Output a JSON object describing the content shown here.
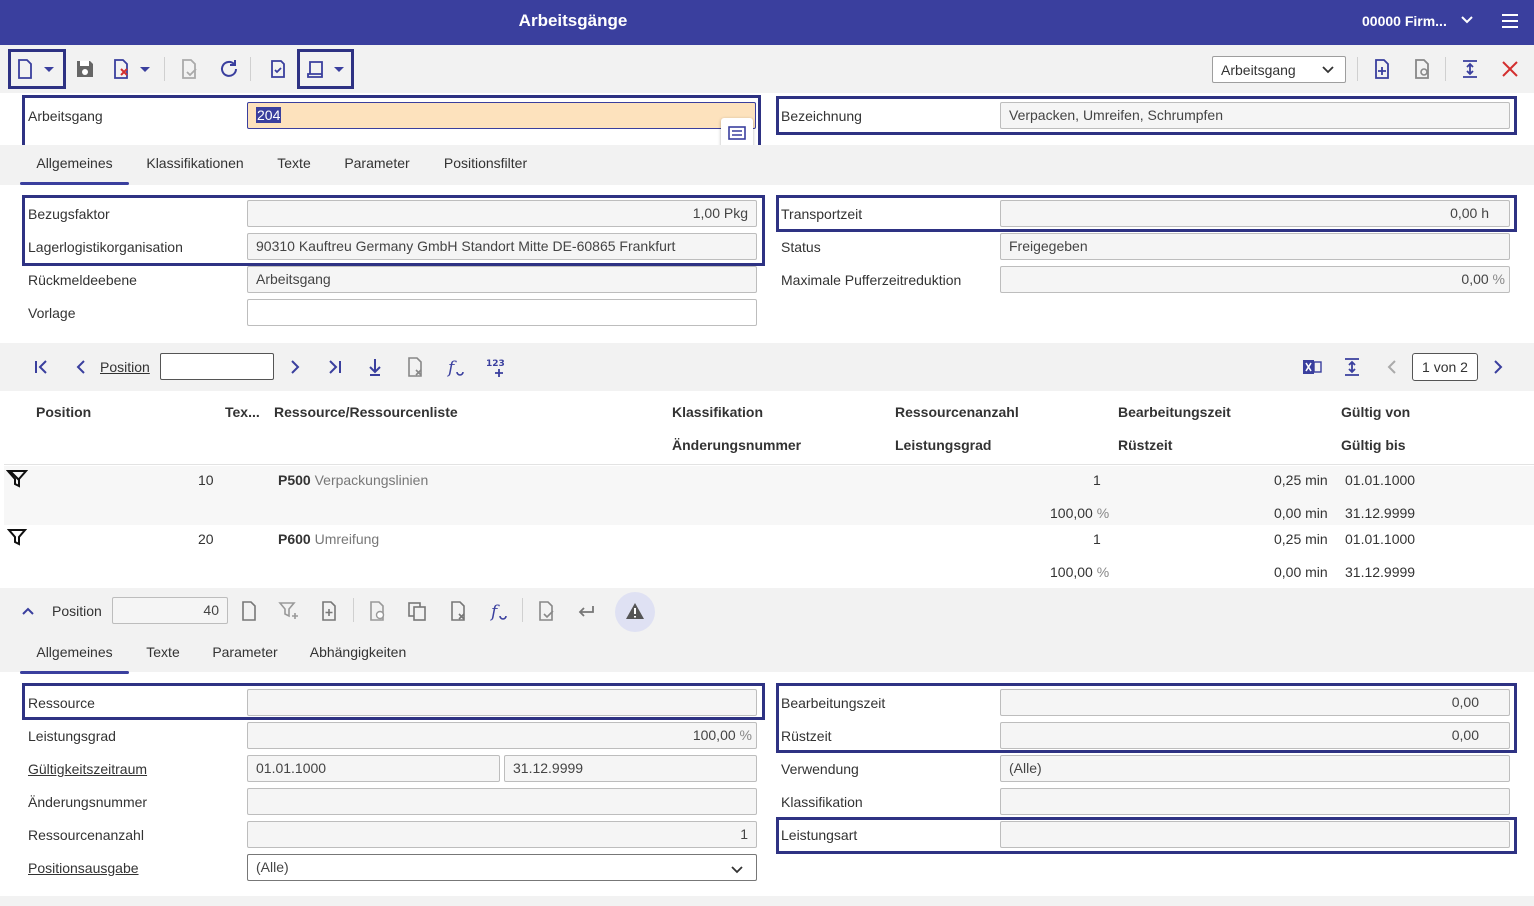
{
  "header": {
    "title": "Arbeitsgänge",
    "company": "00000 Firm..."
  },
  "toolbar": {
    "view_select": "Arbeitsgang"
  },
  "top": {
    "arbeitsgang_label": "Arbeitsgang",
    "arbeitsgang_value": "204",
    "bezeichnung_label": "Bezeichnung",
    "bezeichnung_value": "Verpacken, Umreifen, Schrumpfen"
  },
  "tabs": [
    "Allgemeines",
    "Klassifikationen",
    "Texte",
    "Parameter",
    "Positionsfilter"
  ],
  "general": {
    "bezugsfaktor_label": "Bezugsfaktor",
    "bezugsfaktor_value": "1,00 Pkg",
    "lager_label": "Lagerlogistikorganisation",
    "lager_value": "90310 Kauftreu Germany GmbH Standort Mitte DE-60865 Frankfurt",
    "rueck_label": "Rückmeldeebene",
    "rueck_value": "Arbeitsgang",
    "vorlage_label": "Vorlage",
    "vorlage_value": "",
    "transport_label": "Transportzeit",
    "transport_value": "0,00 h",
    "status_label": "Status",
    "status_value": "Freigegeben",
    "puffer_label": "Maximale Pufferzeitreduktion",
    "puffer_value": "0,00",
    "puffer_unit": "%"
  },
  "grid_toolbar": {
    "position_label": "Position",
    "pager": "1 von 2"
  },
  "table": {
    "headers": {
      "position": "Position",
      "text": "Tex...",
      "ressource": "Ressource/Ressourcenliste",
      "klassifikation": "Klassifikation",
      "anzahl": "Ressourcenanzahl",
      "bearbeitungszeit": "Bearbeitungszeit",
      "gueltig_von": "Gültig von",
      "aenderungsnummer": "Änderungsnummer",
      "leistungsgrad": "Leistungsgrad",
      "ruestzeit": "Rüstzeit",
      "gueltig_bis": "Gültig bis"
    },
    "rows": [
      {
        "position": "10",
        "code": "P500",
        "name": "Verpackungslinien",
        "anzahl": "1",
        "bearbeitungszeit": "0,25 min",
        "gueltig_von": "01.01.1000",
        "leistungsgrad": "100,00",
        "leistungsgrad_unit": "%",
        "ruestzeit": "0,00 min",
        "gueltig_bis": "31.12.9999"
      },
      {
        "position": "20",
        "code": "P600",
        "name": "Umreifung",
        "anzahl": "1",
        "bearbeitungszeit": "0,25 min",
        "gueltig_von": "01.01.1000",
        "leistungsgrad": "100,00",
        "leistungsgrad_unit": "%",
        "ruestzeit": "0,00 min",
        "gueltig_bis": "31.12.9999"
      }
    ]
  },
  "detail_toolbar": {
    "position_label": "Position",
    "position_value": "40"
  },
  "detail_tabs": [
    "Allgemeines",
    "Texte",
    "Parameter",
    "Abhängigkeiten"
  ],
  "detail": {
    "ressource_label": "Ressource",
    "ressource_value": "",
    "leistungsgrad_label": "Leistungsgrad",
    "leistungsgrad_value": "100,00",
    "leistungsgrad_unit": "%",
    "gueltig_label": "Gültigkeitszeitraum",
    "gueltig_from": "01.01.1000",
    "gueltig_to": "31.12.9999",
    "aenderung_label": "Änderungsnummer",
    "aenderung_value": "",
    "anzahl_label": "Ressourcenanzahl",
    "anzahl_value": "1",
    "ausgabe_label": "Positionsausgabe",
    "ausgabe_value": "(Alle)",
    "bearbeitung_label": "Bearbeitungszeit",
    "bearbeitung_value": "0,00",
    "ruest_label": "Rüstzeit",
    "ruest_value": "0,00",
    "verwendung_label": "Verwendung",
    "verwendung_value": "(Alle)",
    "klass_label": "Klassifikation",
    "klass_value": "",
    "leistungsart_label": "Leistungsart",
    "leistungsart_value": ""
  },
  "colors": {
    "header": "#3a3f9e",
    "highlight": "#2e3283",
    "selected_input": "#fde2bd",
    "close": "#d32f2f"
  }
}
